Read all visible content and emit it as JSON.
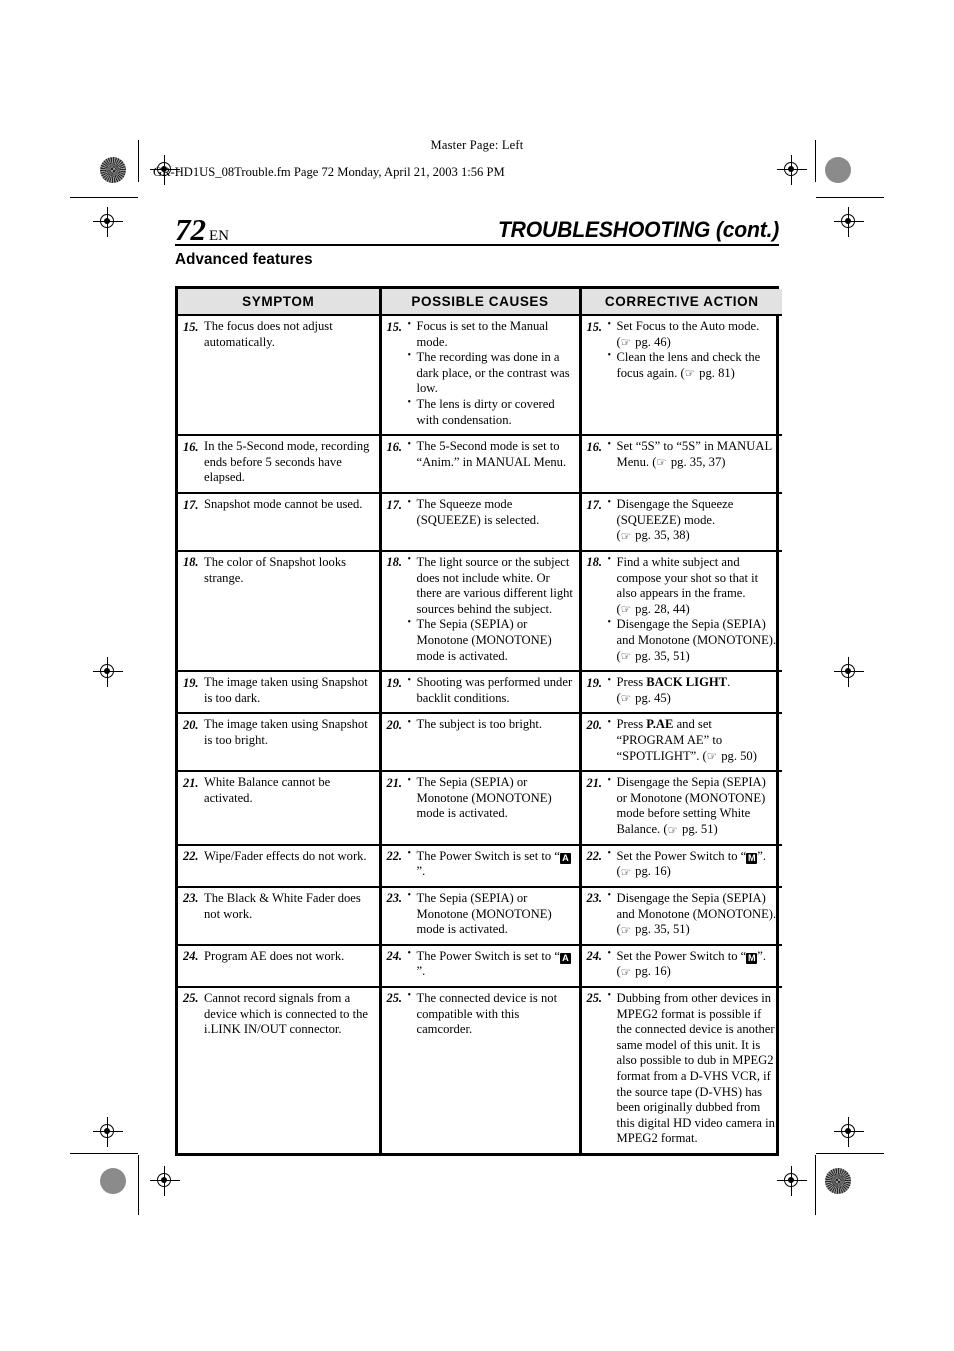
{
  "header": {
    "master_page": "Master Page: Left",
    "file_line": "GR-HD1US_08Trouble.fm  Page 72  Monday, April 21, 2003  1:56 PM"
  },
  "title": {
    "page_number": "72",
    "language_code": "EN",
    "doc_title": "TROUBLESHOOTING (cont.)",
    "section_heading": "Advanced features"
  },
  "table": {
    "columns": [
      {
        "label": "SYMPTOM"
      },
      {
        "label": "POSSIBLE CAUSES"
      },
      {
        "label": "CORRECTIVE ACTION"
      }
    ],
    "rows": [
      {
        "num": "15.",
        "symptom": "The focus does not adjust automatically.",
        "causes": [
          "Focus is set to the Manual mode.",
          "The recording was done in a dark place, or the contrast was low.",
          "The lens is dirty or covered with condensation."
        ],
        "actions": [
          {
            "text": "Set Focus to the Auto mode.",
            "ref": "pg. 46"
          },
          {
            "text": "Clean the lens and check the focus again.",
            "ref": "pg. 81",
            "ref_inline": true
          }
        ]
      },
      {
        "num": "16.",
        "symptom": "In the 5-Second mode, recording ends before 5 seconds have elapsed.",
        "causes": [
          "The 5-Second mode is set to “Anim.” in MANUAL Menu."
        ],
        "actions": [
          {
            "text": "Set “5S” to “5S” in MANUAL Menu.",
            "ref": "pg. 35, 37",
            "ref_inline": true
          }
        ]
      },
      {
        "num": "17.",
        "symptom": "Snapshot mode cannot be used.",
        "causes": [
          "The Squeeze mode (SQUEEZE) is selected."
        ],
        "actions": [
          {
            "text": "Disengage the Squeeze (SQUEEZE) mode.",
            "ref": "pg. 35, 38"
          }
        ]
      },
      {
        "num": "18.",
        "symptom": "The color of Snapshot looks strange.",
        "causes": [
          "The light source or the subject does not include white. Or there are various different light sources behind the subject.",
          "The Sepia (SEPIA) or Monotone (MONOTONE) mode is activated."
        ],
        "actions": [
          {
            "text": "Find a white subject and compose your shot so that it also appears in the frame.",
            "ref": "pg. 28, 44"
          },
          {
            "text": "Disengage the Sepia (SEPIA) and Monotone (MONOTONE).",
            "ref": "pg. 35, 51",
            "ref_inline": true
          }
        ]
      },
      {
        "num": "19.",
        "symptom": "The image taken using Snapshot is too dark.",
        "causes": [
          "Shooting was performed under backlit conditions."
        ],
        "actions": [
          {
            "text": "Press BACK LIGHT.",
            "bold": "BACK LIGHT",
            "ref": "pg. 45"
          }
        ]
      },
      {
        "num": "20.",
        "symptom": "The image taken using Snapshot is too bright.",
        "causes": [
          "The subject is too bright."
        ],
        "actions": [
          {
            "text": "Press P.AE and set “PROGRAM AE” to “SPOTLIGHT”.",
            "bold": "P.AE",
            "ref": "pg. 50",
            "ref_inline": true
          }
        ]
      },
      {
        "num": "21.",
        "symptom": "White Balance cannot be activated.",
        "causes": [
          "The Sepia (SEPIA) or Monotone (MONOTONE) mode is activated."
        ],
        "actions": [
          {
            "text": "Disengage the Sepia (SEPIA) or Monotone (MONOTONE) mode before setting White Balance.",
            "ref": "pg. 51",
            "ref_inline": true
          }
        ]
      },
      {
        "num": "22.",
        "symptom": "Wipe/Fader effects do not work.",
        "causes": [
          {
            "text_before": "The Power Switch is set to “",
            "mode_glyph": "A",
            "text_after": "”."
          }
        ],
        "actions": [
          {
            "text_before": "Set the Power Switch to “",
            "mode_glyph": "M",
            "text_after": "”.",
            "ref": "pg. 16"
          }
        ]
      },
      {
        "num": "23.",
        "symptom": "The Black & White Fader does not work.",
        "causes": [
          "The Sepia (SEPIA) or Monotone (MONOTONE) mode is activated."
        ],
        "actions": [
          {
            "text": "Disengage the Sepia (SEPIA) and Monotone (MONOTONE).",
            "ref": "pg. 35, 51"
          }
        ]
      },
      {
        "num": "24.",
        "symptom": "Program AE does not work.",
        "causes": [
          {
            "text_before": "The Power Switch is set to “",
            "mode_glyph": "A",
            "text_after": "”."
          }
        ],
        "actions": [
          {
            "text_before": "Set the Power Switch to “",
            "mode_glyph": "M",
            "text_after": "”.",
            "ref": "pg. 16"
          }
        ]
      },
      {
        "num": "25.",
        "symptom": "Cannot record signals from a device which is connected to the i.LINK IN/OUT connector.",
        "causes": [
          "The connected device is not compatible with this camcorder."
        ],
        "actions": [
          {
            "text": "Dubbing from other devices in MPEG2 format is possible if the connected device is another same model of this unit. It is also possible to dub in MPEG2 format from a D-VHS VCR, if the source tape (D-VHS) has been originally dubbed from this digital HD video camera in MPEG2 format."
          }
        ]
      }
    ]
  },
  "icons": {
    "page_reference": "☞",
    "registration_mark": "registration-mark",
    "halftone_target": "halftone-target"
  },
  "colors": {
    "header_fill": "#e2e2e2",
    "rule": "#000000",
    "page_background": "#ffffff"
  }
}
